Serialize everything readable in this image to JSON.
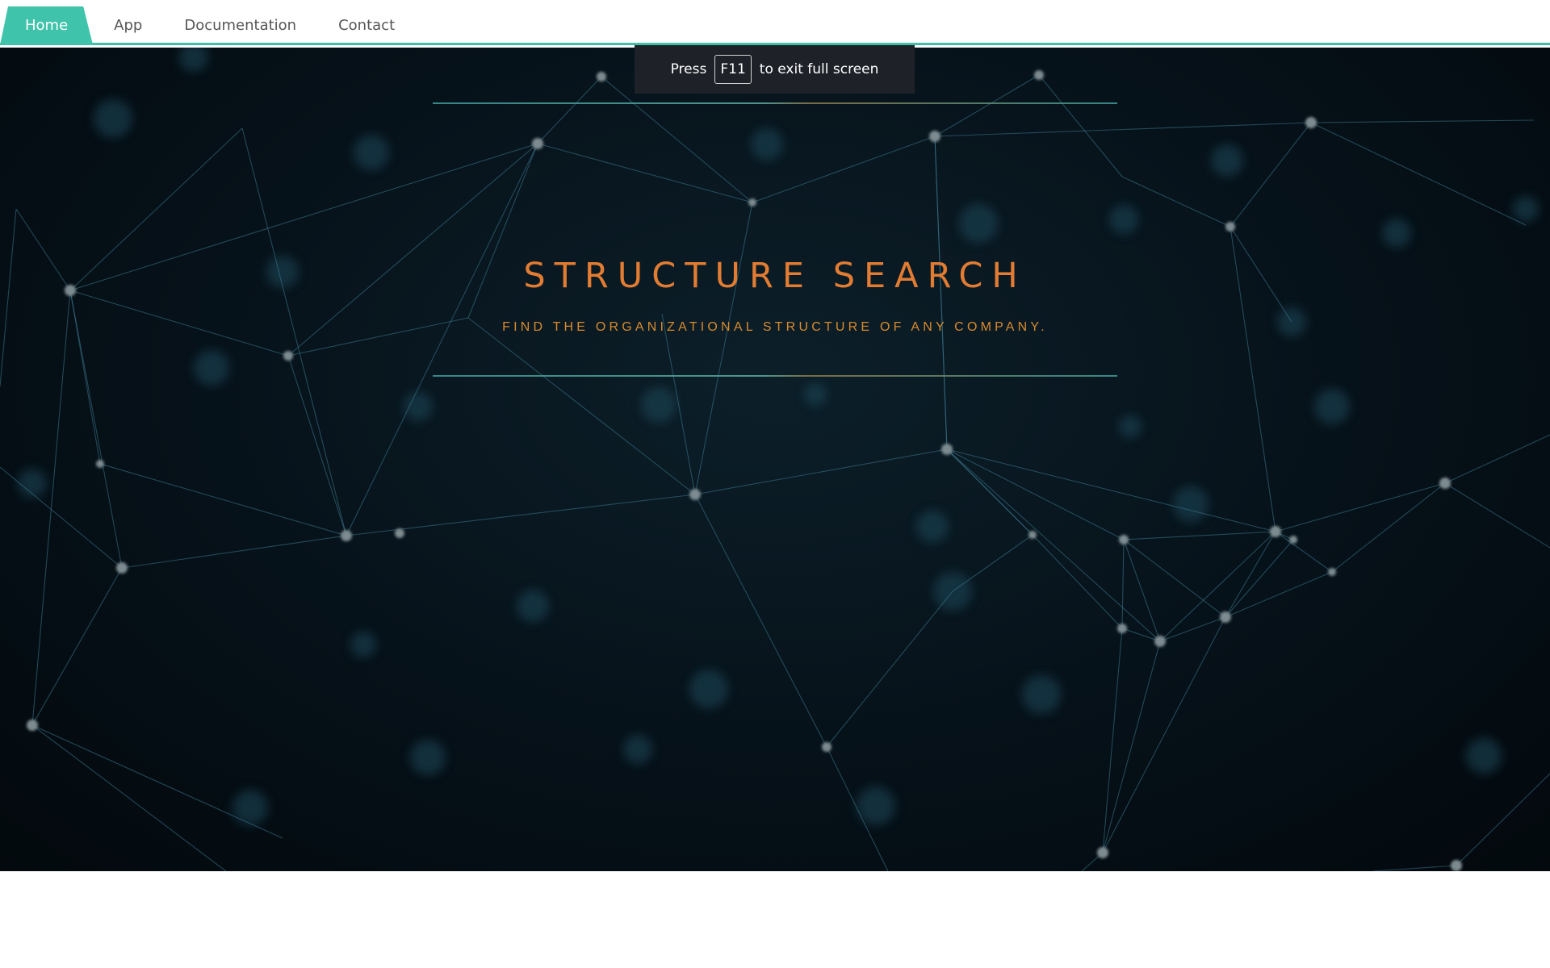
{
  "nav": {
    "tabs": [
      {
        "label": "Home",
        "active": true
      },
      {
        "label": "App",
        "active": false
      },
      {
        "label": "Documentation",
        "active": false
      },
      {
        "label": "Contact",
        "active": false
      }
    ],
    "accent_color": "#40c3ab"
  },
  "fullscreen_notice": {
    "prefix": "Press",
    "key": "F11",
    "suffix": "to exit full screen"
  },
  "hero": {
    "title": "STRUCTURE SEARCH",
    "subtitle": "FIND THE ORGANIZATIONAL STRUCTURE OF ANY COMPANY.",
    "title_color": "#e27c33",
    "background_color": "#061119"
  }
}
